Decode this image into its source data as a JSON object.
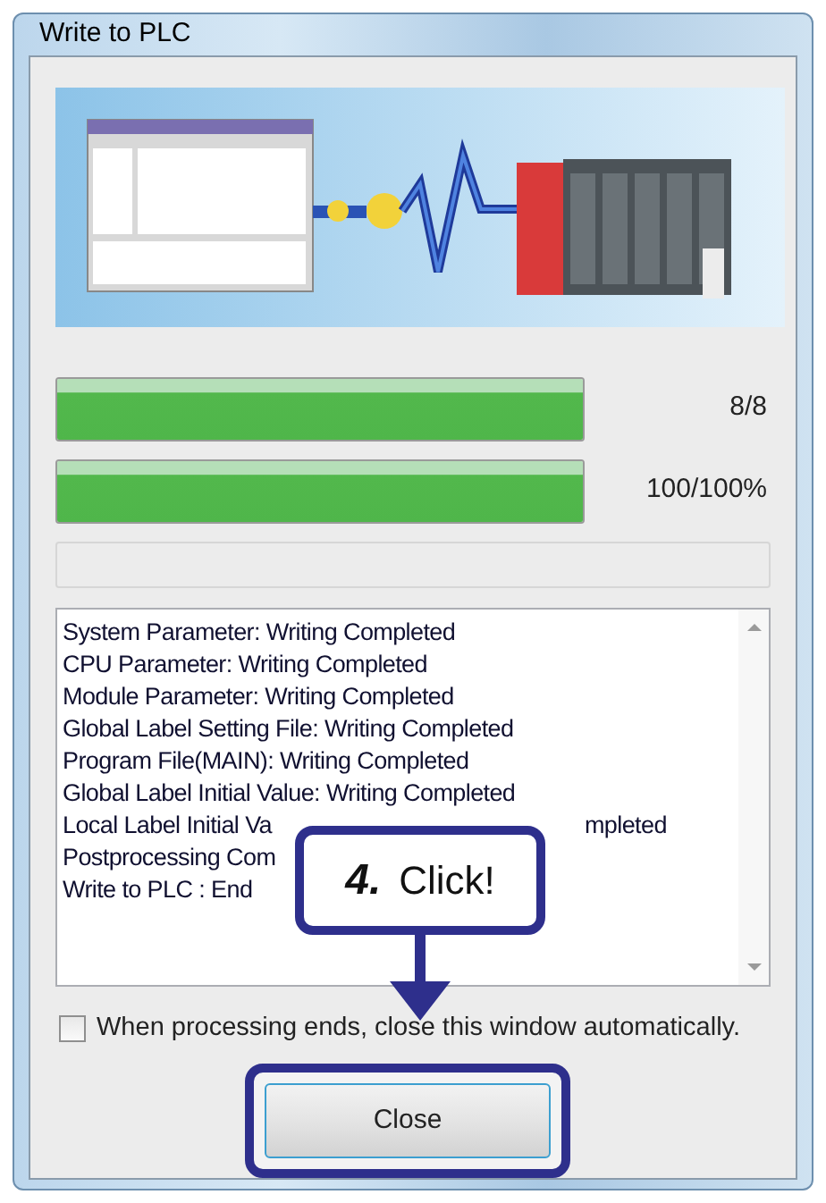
{
  "window": {
    "title": "Write to PLC"
  },
  "progress": [
    {
      "level": 1,
      "reading": "8/8"
    },
    {
      "level": 1,
      "reading": "100/100%"
    },
    {
      "level": 0
    }
  ],
  "log": [
    [
      "System Parameter: Writing Completed"
    ],
    [
      "CPU Parameter: Writing Completed"
    ],
    [
      "Module Parameter: Writing Completed"
    ],
    [
      "Global Label Setting File: Writing Completed"
    ],
    [
      "Program File(MAIN): Writing Completed"
    ],
    [
      "Global Label Initial Value: Writing Completed"
    ],
    [
      "Local Label Initial Va",
      "mpleted"
    ],
    [
      "Postprocessing Com"
    ],
    [
      "Write to PLC : End"
    ]
  ],
  "auto_close": {
    "label": "When processing ends, close this window automatically.",
    "checked": false
  },
  "close_button": "Close",
  "callout": {
    "step": "4.",
    "text": "Click!"
  }
}
